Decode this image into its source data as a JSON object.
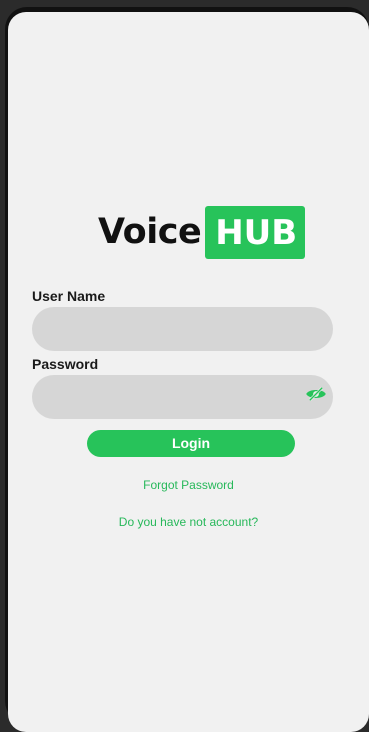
{
  "logo": {
    "word": "Voice",
    "badge": "HUB"
  },
  "form": {
    "username_label": "User Name",
    "username_value": "",
    "password_label": "Password",
    "password_value": "",
    "visibility_icon": "eye-slash-icon",
    "login_label": "Login"
  },
  "links": {
    "forgot_password": "Forgot Password",
    "no_account": "Do you have not account?"
  },
  "colors": {
    "accent": "#27c35a",
    "screen_background": "#f1f1f1",
    "field_background": "#d6d6d6",
    "frame": "#111111"
  }
}
